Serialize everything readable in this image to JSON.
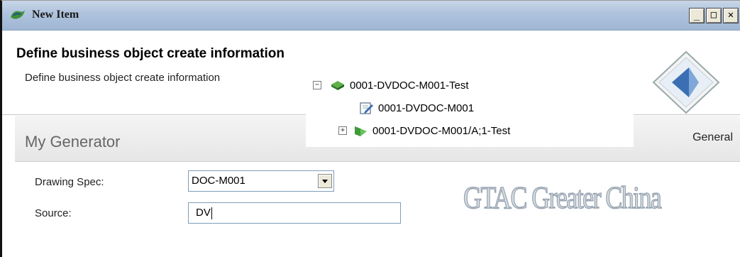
{
  "window": {
    "title": "New Item",
    "controls": {
      "minimize": "_",
      "maximize": "□",
      "close": "✕"
    }
  },
  "header": {
    "title": "Define business object create information",
    "description": "Define business object create information"
  },
  "tree": {
    "items": [
      {
        "label": "0001-DVDOC-M001-Test",
        "expander": "−",
        "icon": "item-icon"
      },
      {
        "label": "0001-DVDOC-M001",
        "icon": "dataset-icon"
      },
      {
        "label": "0001-DVDOC-M001/A;1-Test",
        "expander": "+",
        "icon": "item-revision-icon"
      }
    ]
  },
  "generator": {
    "title": "My Generator",
    "tab": "General"
  },
  "form": {
    "drawing_spec": {
      "label": "Drawing Spec:",
      "value": "DOC-M001"
    },
    "source": {
      "label": "Source:",
      "value": "DV"
    }
  },
  "watermark": "GTAC Greater China",
  "colors": {
    "titlebar": "#aec2dc",
    "accent_green": "#2f8f2f",
    "logo_blue": "#3a6fb4"
  }
}
